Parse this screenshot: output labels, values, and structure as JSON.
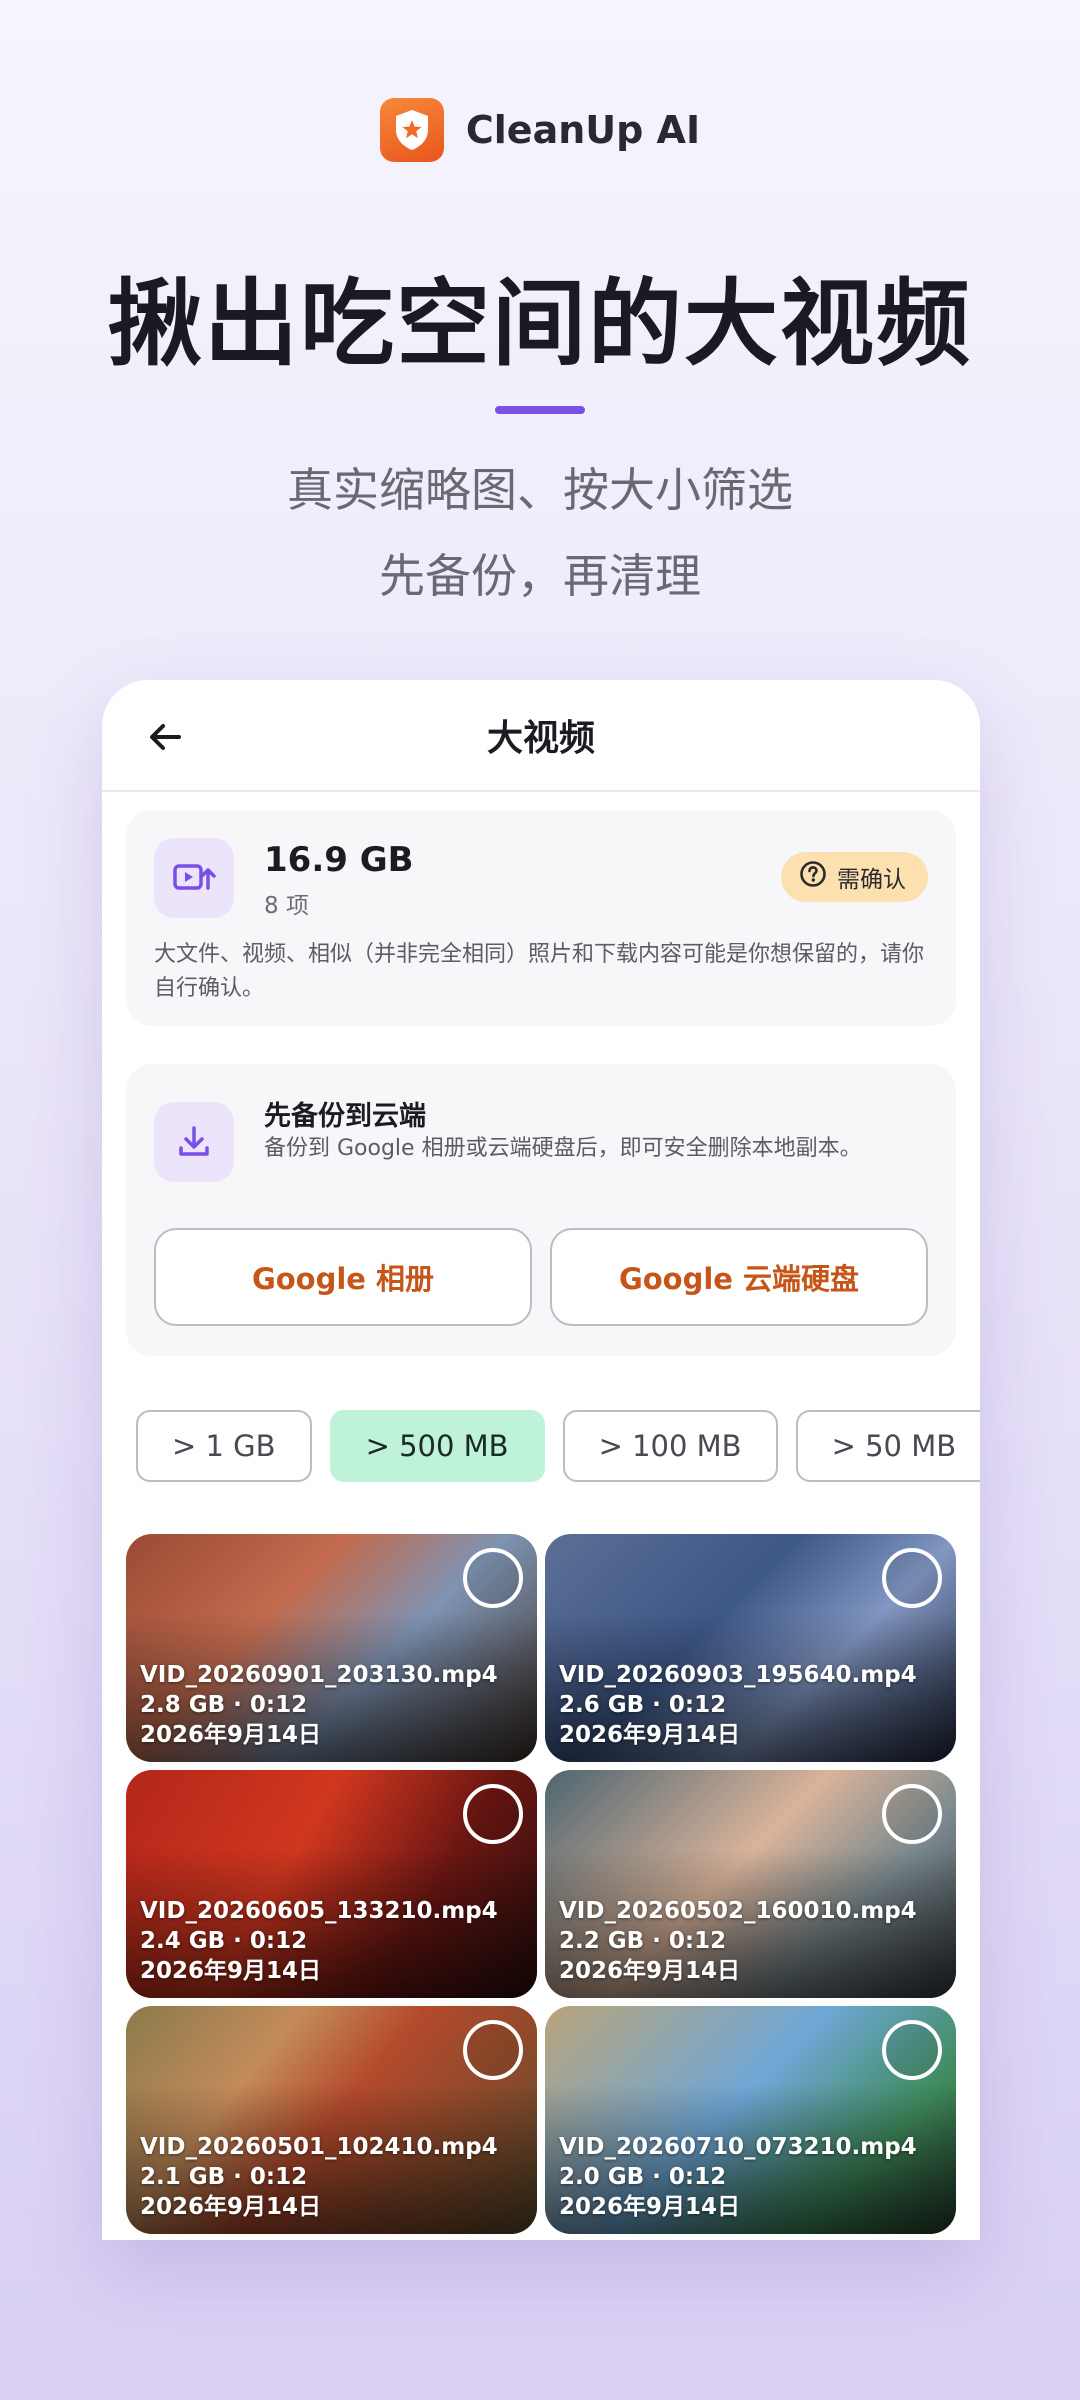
{
  "brand": {
    "name": "CleanUp AI",
    "logo_icon": "shield-icon",
    "logo_color": "#ef6d28"
  },
  "headline": "揪出吃空间的大视频",
  "subline_1": "真实缩略图、按大小筛选",
  "subline_2": "先备份，再清理",
  "accent_color": "#7a4fe6",
  "screen": {
    "title": "大视频",
    "summary": {
      "size": "16.9 GB",
      "count": "8 项",
      "badge": "需确认",
      "note": "大文件、视频、相似（并非完全相同）照片和下载内容可能是你想保留的，请你自行确认。"
    },
    "backup": {
      "title": "先备份到云端",
      "description": "备份到 Google 相册或云端硬盘后，即可安全删除本地副本。",
      "google_photos": "Google 相册",
      "google_drive": "Google 云端硬盘"
    },
    "filters": [
      {
        "label": "> 1 GB",
        "active": false
      },
      {
        "label": "> 500 MB",
        "active": true
      },
      {
        "label": "> 100 MB",
        "active": false
      },
      {
        "label": "> 50 MB",
        "active": false
      }
    ],
    "videos": [
      {
        "name": "VID_20260901_203130.mp4",
        "info": "2.8 GB · 0:12",
        "date": "2026年9月14日"
      },
      {
        "name": "VID_20260903_195640.mp4",
        "info": "2.6 GB · 0:12",
        "date": "2026年9月14日"
      },
      {
        "name": "VID_20260605_133210.mp4",
        "info": "2.4 GB · 0:12",
        "date": "2026年9月14日"
      },
      {
        "name": "VID_20260502_160010.mp4",
        "info": "2.2 GB · 0:12",
        "date": "2026年9月14日"
      },
      {
        "name": "VID_20260501_102410.mp4",
        "info": "2.1 GB · 0:12",
        "date": "2026年9月14日"
      },
      {
        "name": "VID_20260710_073210.mp4",
        "info": "2.0 GB · 0:12",
        "date": "2026年9月14日"
      }
    ]
  }
}
